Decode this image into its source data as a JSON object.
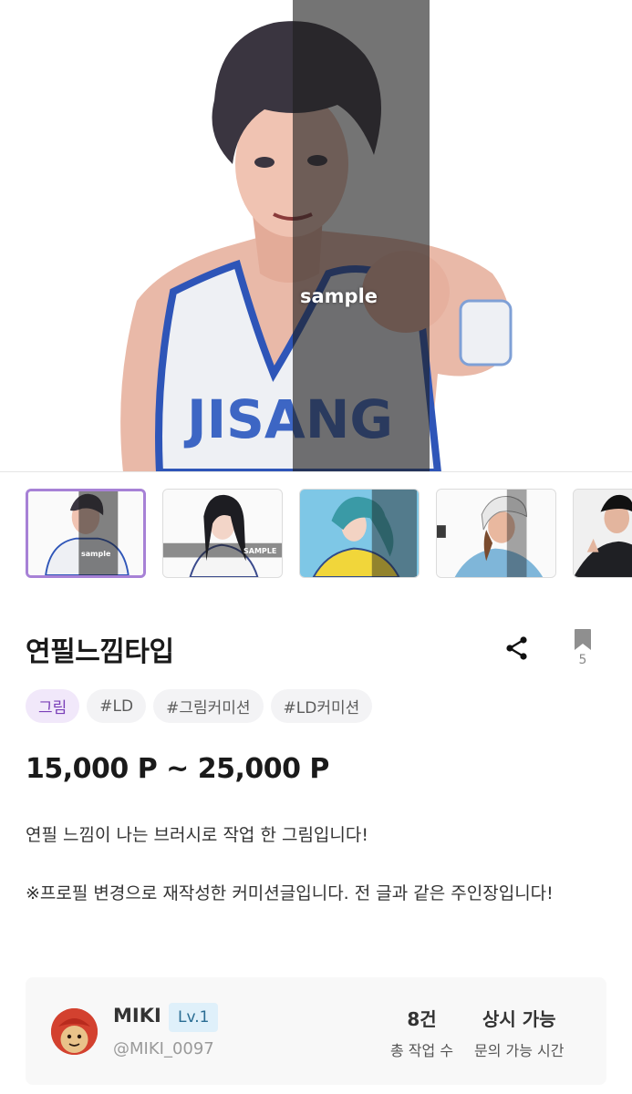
{
  "hero": {
    "watermark": "sample"
  },
  "thumbnails": [
    {
      "watermark": "sample",
      "selected": true
    },
    {
      "watermark": "SAMPLE",
      "selected": false
    },
    {
      "watermark": "",
      "selected": false
    },
    {
      "watermark": "",
      "selected": false
    },
    {
      "watermark": "",
      "selected": false
    }
  ],
  "product": {
    "title": "연필느낌타입",
    "bookmark_count": "5",
    "tags": [
      "그림",
      "#LD",
      "#그림커미션",
      "#LD커미션"
    ],
    "price": "15,000 P ~ 25,000 P",
    "description": [
      "연필 느낌이 나는 브러시로 작업 한 그림입니다!",
      "※프로필 변경으로 재작성한 커미션글입니다. 전 글과 같은 주인장입니다!"
    ]
  },
  "seller": {
    "name": "MIKI",
    "level": "Lv.1",
    "handle": "@MIKI_0097",
    "stats": [
      {
        "value": "8건",
        "label": "총 작업 수"
      },
      {
        "value": "상시 가능",
        "label": "문의 가능 시간"
      }
    ]
  },
  "colors": {
    "accent": "#a781d6",
    "tag_category_bg": "#f1e8fa",
    "tag_category_text": "#7a3fb8",
    "level_badge_bg": "#dff0fa"
  }
}
